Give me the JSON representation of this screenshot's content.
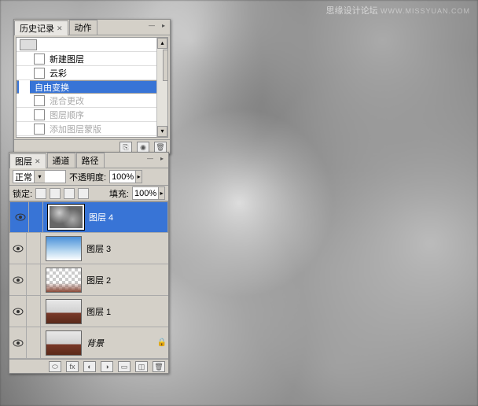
{
  "watermark": {
    "main": "思缘设计论坛",
    "sub": "WWW.MISSYUAN.COM"
  },
  "history": {
    "tabs": [
      {
        "label": "历史记录",
        "active": true
      },
      {
        "label": "动作",
        "active": false
      }
    ],
    "items": [
      {
        "label": "新建图层",
        "dim": false
      },
      {
        "label": "云彩",
        "dim": false
      },
      {
        "label": "自由变换",
        "sel": true
      },
      {
        "label": "混合更改",
        "dim": true
      },
      {
        "label": "图层顺序",
        "dim": true
      },
      {
        "label": "添加图层蒙版",
        "dim": true
      }
    ]
  },
  "layers": {
    "tabs": [
      {
        "label": "图层",
        "active": true
      },
      {
        "label": "通道"
      },
      {
        "label": "路径"
      }
    ],
    "blend": "正常",
    "opacity_label": "不透明度:",
    "opacity": "100%",
    "lock_label": "锁定:",
    "fill_label": "填充:",
    "fill": "100%",
    "items": [
      {
        "name": "图层 4",
        "sel": true,
        "thumb": "clouds-t"
      },
      {
        "name": "图层 3",
        "thumb": "sky"
      },
      {
        "name": "图层 2",
        "thumb": "checker"
      },
      {
        "name": "图层 1",
        "thumb": "castle"
      },
      {
        "name": "背景",
        "thumb": "castle",
        "locked": true,
        "italic": true
      }
    ]
  }
}
